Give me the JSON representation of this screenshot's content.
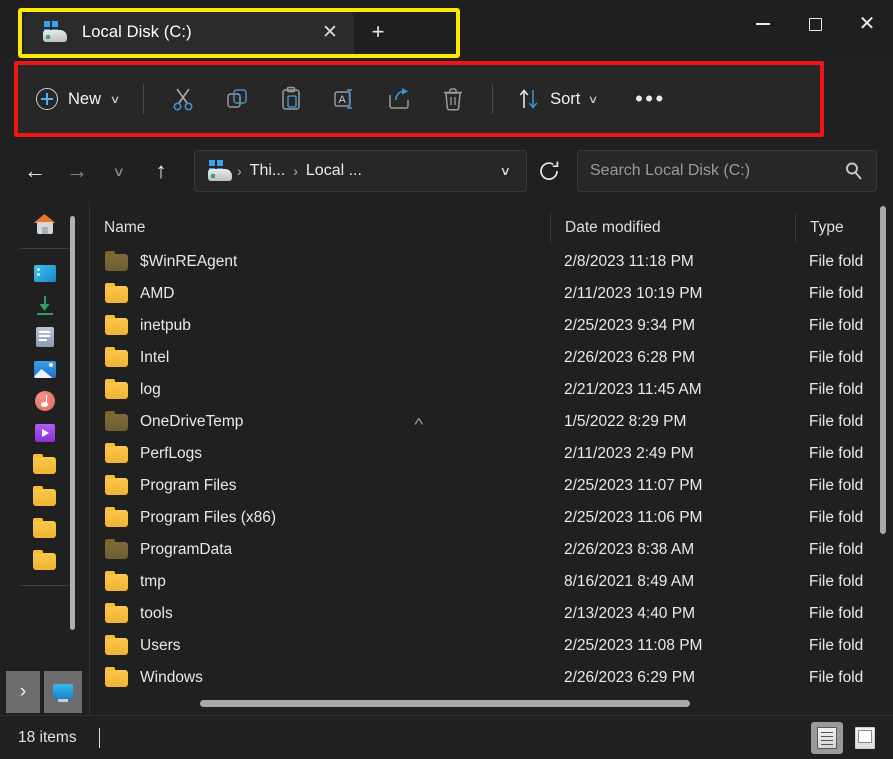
{
  "window": {
    "controls": {
      "minimize": "–",
      "maximize": "□",
      "close": "✕"
    }
  },
  "tabbar": {
    "tabs": [
      {
        "label": "Local Disk (C:)",
        "icon": "drive-icon",
        "close_label": "✕",
        "active": true
      }
    ],
    "new_tab_label": "+",
    "highlight_color": "#ffe800"
  },
  "toolbar": {
    "highlight_color": "#f01515",
    "new_label": "New",
    "new_chevron": "∨",
    "sort_label": "Sort",
    "sort_chevron": "∨",
    "more_label": "•••",
    "items": [
      {
        "name": "cut",
        "icon": "scissors-icon"
      },
      {
        "name": "copy",
        "icon": "copy-icon"
      },
      {
        "name": "paste",
        "icon": "clipboard-paste-icon"
      },
      {
        "name": "rename",
        "icon": "rename-icon"
      },
      {
        "name": "share",
        "icon": "share-icon"
      },
      {
        "name": "delete",
        "icon": "trash-icon"
      }
    ]
  },
  "addressbar": {
    "back": "←",
    "forward": "→",
    "recent_chevron": "∨",
    "up": "↑",
    "breadcrumb": {
      "icon": "drive-icon",
      "sep": "›",
      "parts": [
        "Thi...",
        "Local ..."
      ],
      "chevron": "∨"
    },
    "refresh_icon": "refresh-icon",
    "search": {
      "placeholder": "Search Local Disk (C:)",
      "value": "",
      "icon": "search-icon"
    }
  },
  "sidebar": {
    "items": [
      {
        "name": "home",
        "icon": "home-icon"
      },
      {
        "name": "onedrive",
        "icon": "onedrive-icon"
      },
      {
        "name": "downloads",
        "icon": "download-icon"
      },
      {
        "name": "documents",
        "icon": "documents-icon"
      },
      {
        "name": "pictures",
        "icon": "pictures-icon"
      },
      {
        "name": "music",
        "icon": "music-icon"
      },
      {
        "name": "videos",
        "icon": "videos-icon"
      },
      {
        "name": "folder-1",
        "icon": "folder-icon"
      },
      {
        "name": "folder-2",
        "icon": "folder-icon"
      },
      {
        "name": "folder-3",
        "icon": "folder-icon"
      },
      {
        "name": "folder-4",
        "icon": "folder-icon"
      }
    ],
    "expand_label": "›",
    "this_pc_icon": "pc-icon"
  },
  "filelist": {
    "sort_caret": "˄",
    "columns": [
      "Name",
      "Date modified",
      "Type"
    ],
    "rows": [
      {
        "name": "$WinREAgent",
        "date": "2/8/2023 11:18 PM",
        "type": "File fold",
        "hidden": true
      },
      {
        "name": "AMD",
        "date": "2/11/2023 10:19 PM",
        "type": "File fold",
        "hidden": false
      },
      {
        "name": "inetpub",
        "date": "2/25/2023 9:34 PM",
        "type": "File fold",
        "hidden": false
      },
      {
        "name": "Intel",
        "date": "2/26/2023 6:28 PM",
        "type": "File fold",
        "hidden": false
      },
      {
        "name": "log",
        "date": "2/21/2023 11:45 AM",
        "type": "File fold",
        "hidden": false
      },
      {
        "name": "OneDriveTemp",
        "date": "1/5/2022 8:29 PM",
        "type": "File fold",
        "hidden": true
      },
      {
        "name": "PerfLogs",
        "date": "2/11/2023 2:49 PM",
        "type": "File fold",
        "hidden": false
      },
      {
        "name": "Program Files",
        "date": "2/25/2023 11:07 PM",
        "type": "File fold",
        "hidden": false
      },
      {
        "name": "Program Files (x86)",
        "date": "2/25/2023 11:06 PM",
        "type": "File fold",
        "hidden": false
      },
      {
        "name": "ProgramData",
        "date": "2/26/2023 8:38 AM",
        "type": "File fold",
        "hidden": true
      },
      {
        "name": "tmp",
        "date": "8/16/2021 8:49 AM",
        "type": "File fold",
        "hidden": false
      },
      {
        "name": "tools",
        "date": "2/13/2023 4:40 PM",
        "type": "File fold",
        "hidden": false
      },
      {
        "name": "Users",
        "date": "2/25/2023 11:08 PM",
        "type": "File fold",
        "hidden": false
      },
      {
        "name": "Windows",
        "date": "2/26/2023 6:29 PM",
        "type": "File fold",
        "hidden": false
      }
    ]
  },
  "statusbar": {
    "item_count": "18 items",
    "views": [
      {
        "name": "details-view",
        "selected": true
      },
      {
        "name": "large-icons-view",
        "selected": false
      }
    ]
  }
}
